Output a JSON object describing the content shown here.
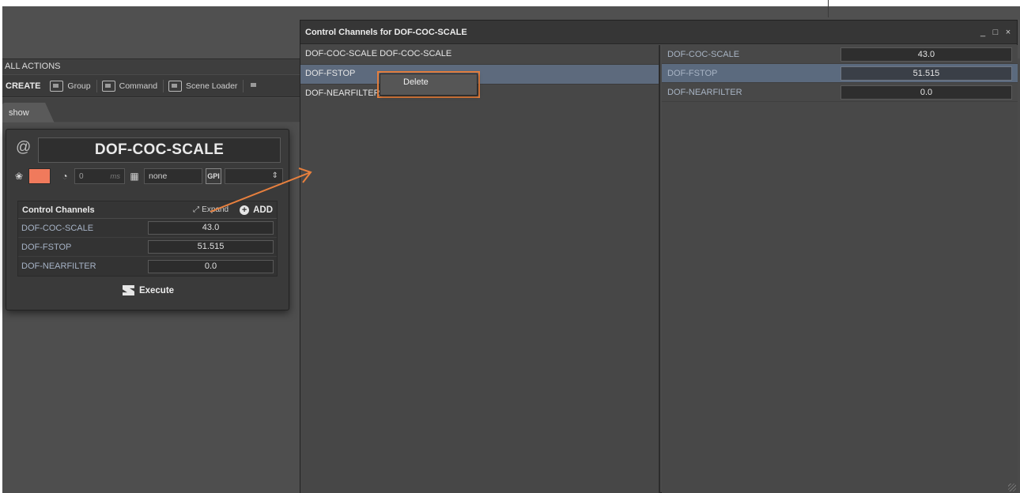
{
  "app": {
    "all_actions_label": "ALL ACTIONS",
    "toolbar": {
      "create_label": "CREATE",
      "items": [
        {
          "label": "Group",
          "icon": "group-icon"
        },
        {
          "label": "Command",
          "icon": "command-icon"
        },
        {
          "label": "Scene Loader",
          "icon": "scene-loader-icon"
        }
      ]
    },
    "tab_label": "show"
  },
  "action_card": {
    "at_symbol": "@",
    "title": "DOF-COC-SCALE",
    "color": "#f07a5c",
    "delay_value": "0",
    "delay_unit": "ms",
    "keyboard_value": "none",
    "gpi_label": "GPI",
    "gpi_select_value": "",
    "control_channels": {
      "title": "Control Channels",
      "expand_label": "Expand",
      "add_label": "ADD",
      "rows": [
        {
          "name": "DOF-COC-SCALE",
          "value": "43.0"
        },
        {
          "name": "DOF-FSTOP",
          "value": "51.515"
        },
        {
          "name": "DOF-NEARFILTER",
          "value": "0.0"
        }
      ]
    },
    "execute_label": "Execute"
  },
  "channels_window": {
    "title": "Control Channels for DOF-COC-SCALE",
    "controls": [
      "_",
      "□",
      "×"
    ],
    "left_rows": [
      {
        "text": "DOF-COC-SCALE DOF-COC-SCALE",
        "selected": false
      },
      {
        "text": "DOF-FSTOP",
        "selected": true
      },
      {
        "text": "DOF-NEARFILTER",
        "selected": false
      }
    ],
    "right_rows": [
      {
        "name": "DOF-COC-SCALE",
        "value": "43.0",
        "selected": false
      },
      {
        "name": "DOF-FSTOP",
        "value": "51.515",
        "selected": true
      },
      {
        "name": "DOF-NEARFILTER",
        "value": "0.0",
        "selected": false
      }
    ],
    "context_menu": {
      "item_label": "Delete",
      "highlight_color": "#e8803e"
    }
  }
}
